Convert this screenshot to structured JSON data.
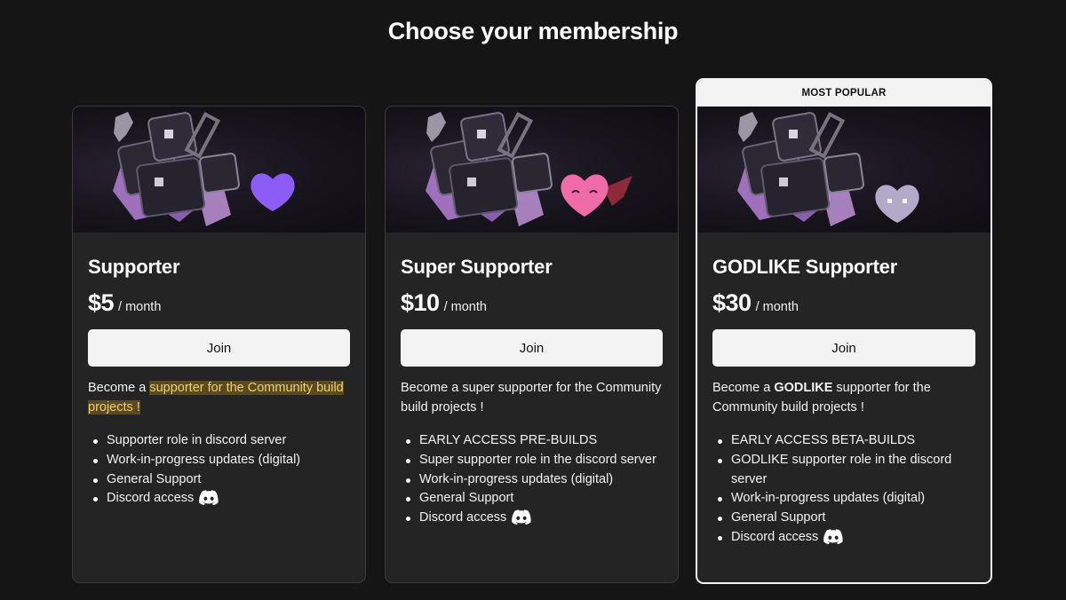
{
  "header": {
    "title": "Choose your membership"
  },
  "tiers": [
    {
      "name": "Supporter",
      "price": "$5",
      "period": "/ month",
      "join_label": "Join",
      "description": {
        "prefix": "Become a ",
        "highlighted": "supporter for the Community build projects !"
      },
      "features": [
        "Supporter role in discord server",
        "Work-in-progress updates (digital)",
        "General Support",
        "Discord access"
      ],
      "heart_icon": "purple-heart-icon",
      "heart_color": "#8b5cf6"
    },
    {
      "name": "Super Supporter",
      "price": "$10",
      "period": "/ month",
      "join_label": "Join",
      "description": {
        "text": "Become a super supporter for the Community build projects !"
      },
      "features": [
        "EARLY ACCESS PRE-BUILDS",
        "Super supporter role in the discord server",
        "Work-in-progress updates (digital)",
        "General Support",
        "Discord access"
      ],
      "heart_icon": "pink-smiling-heart-icon",
      "heart_color": "#f06ca8"
    },
    {
      "badge": "MOST POPULAR",
      "name": "GODLIKE Supporter",
      "price": "$30",
      "period": "/ month",
      "join_label": "Join",
      "description": {
        "prefix": "Become a ",
        "bold": "GODLIKE",
        "suffix": " supporter for the Community build projects !"
      },
      "features": [
        "EARLY ACCESS BETA-BUILDS",
        "GODLIKE supporter role in the discord server",
        "Work-in-progress updates (digital)",
        "General Support",
        "Discord access"
      ],
      "heart_icon": "lavender-heart-icon",
      "heart_color": "#b3a9c9"
    }
  ],
  "colors": {
    "background": "#161515",
    "card": "#242424",
    "button": "#f3f3f3",
    "highlight_text": "#f1cf6a"
  }
}
